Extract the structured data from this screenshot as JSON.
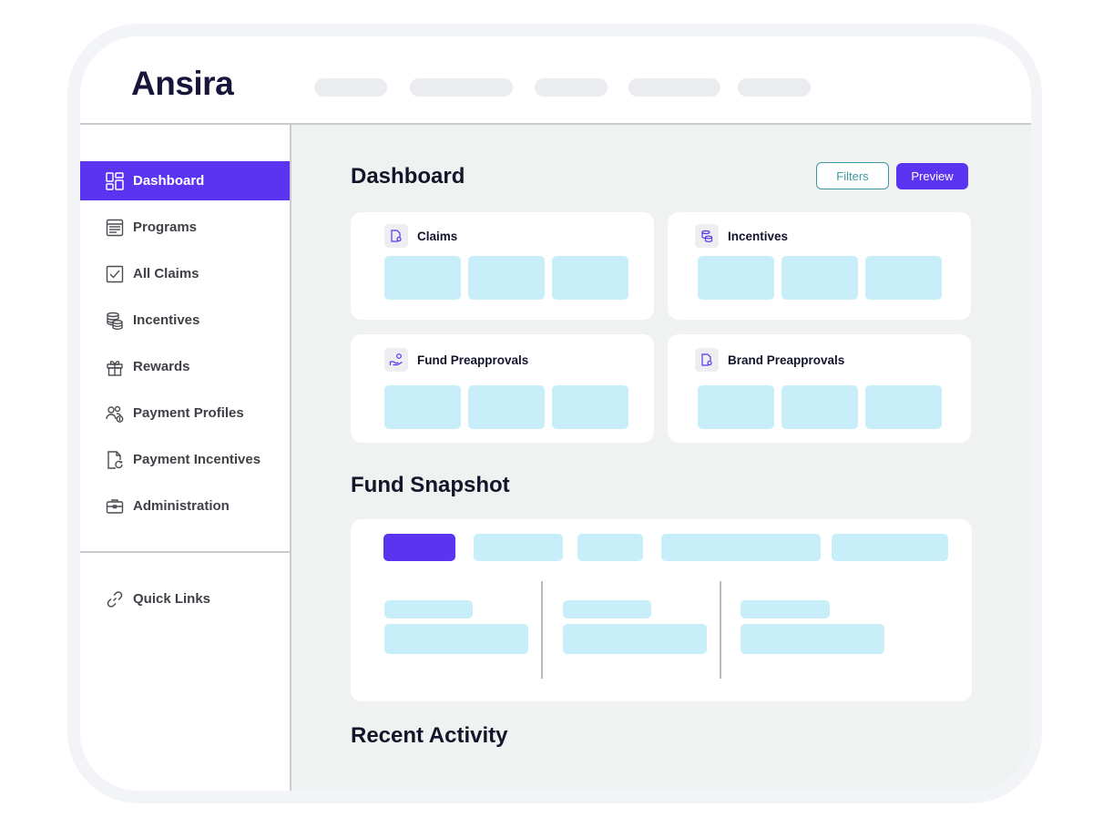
{
  "brand": {
    "logo_text": "Ansira",
    "accent": "#5a34f0",
    "placeholder": "#c8eefa"
  },
  "sidebar": {
    "items": [
      {
        "label": "Dashboard",
        "icon": "dashboard-icon",
        "active": true
      },
      {
        "label": "Programs",
        "icon": "programs-icon"
      },
      {
        "label": "All Claims",
        "icon": "checkbox-icon"
      },
      {
        "label": "Incentives",
        "icon": "coins-icon"
      },
      {
        "label": "Rewards",
        "icon": "gift-icon"
      },
      {
        "label": "Payment Profiles",
        "icon": "users-dollar-icon"
      },
      {
        "label": "Payment Incentives",
        "icon": "document-refresh-icon"
      },
      {
        "label": "Administration",
        "icon": "briefcase-icon"
      }
    ],
    "quick_links": {
      "label": "Quick Links",
      "icon": "link-icon"
    }
  },
  "main": {
    "title": "Dashboard",
    "filters_label": "Filters",
    "preview_label": "Preview",
    "cards": [
      {
        "title": "Claims",
        "icon": "claims-document-icon"
      },
      {
        "title": "Incentives",
        "icon": "coins-icon"
      },
      {
        "title": "Fund Preapprovals",
        "icon": "hand-coin-icon"
      },
      {
        "title": "Brand Preapprovals",
        "icon": "brand-document-icon"
      }
    ],
    "fund_snapshot_title": "Fund Snapshot",
    "recent_activity_title": "Recent Activity"
  }
}
